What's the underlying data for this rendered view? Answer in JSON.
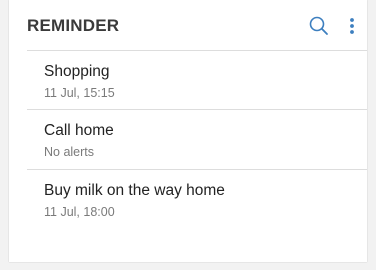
{
  "app": {
    "title": "REMINDER"
  },
  "toolbar": {
    "search_icon": "search-icon",
    "more_icon": "more-vertical-icon"
  },
  "colors": {
    "accent": "#3d7fbf",
    "title_text": "#3a3a3a",
    "item_text": "#222222",
    "sub_text": "#7a7a7a"
  },
  "reminders": [
    {
      "title": "Shopping",
      "subtitle": "11 Jul, 15:15"
    },
    {
      "title": "Call home",
      "subtitle": "No alerts"
    },
    {
      "title": "Buy milk on the way home",
      "subtitle": "11 Jul, 18:00"
    }
  ]
}
